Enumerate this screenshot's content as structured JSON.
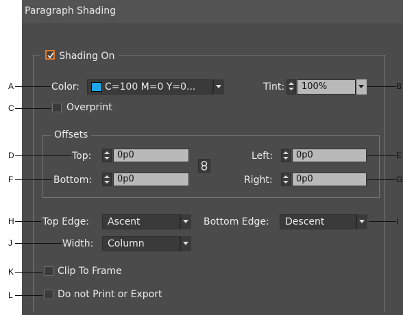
{
  "dialog": {
    "title": "Paragraph Shading"
  },
  "shading_on": {
    "label": "Shading On",
    "checked": true
  },
  "color": {
    "label": "Color:",
    "value": "C=100 M=0 Y=0...",
    "swatch": "#1ea5e8"
  },
  "tint": {
    "label": "Tint:",
    "value": "100%"
  },
  "overprint": {
    "label": "Overprint",
    "checked": false
  },
  "offsets": {
    "legend": "Offsets",
    "top": {
      "label": "Top:",
      "value": "0p0"
    },
    "bottom": {
      "label": "Bottom:",
      "value": "0p0"
    },
    "left": {
      "label": "Left:",
      "value": "0p0"
    },
    "right": {
      "label": "Right:",
      "value": "0p0"
    },
    "link_icon": "chain-link-icon"
  },
  "top_edge": {
    "label": "Top Edge:",
    "value": "Ascent"
  },
  "bottom_edge": {
    "label": "Bottom Edge:",
    "value": "Descent"
  },
  "width": {
    "label": "Width:",
    "value": "Column"
  },
  "clip_to_frame": {
    "label": "Clip To Frame",
    "checked": false
  },
  "do_not_print": {
    "label": "Do not Print or Export",
    "checked": false
  },
  "callouts": {
    "A": "A",
    "B": "B",
    "C": "C",
    "D": "D",
    "E": "E",
    "F": "F",
    "G": "G",
    "H": "H",
    "I": "I",
    "J": "J",
    "K": "K",
    "L": "L"
  },
  "colors": {
    "panel": "#4b4b4b",
    "accent_checkbox": "#e07a27",
    "field": "#b9b9b9"
  }
}
